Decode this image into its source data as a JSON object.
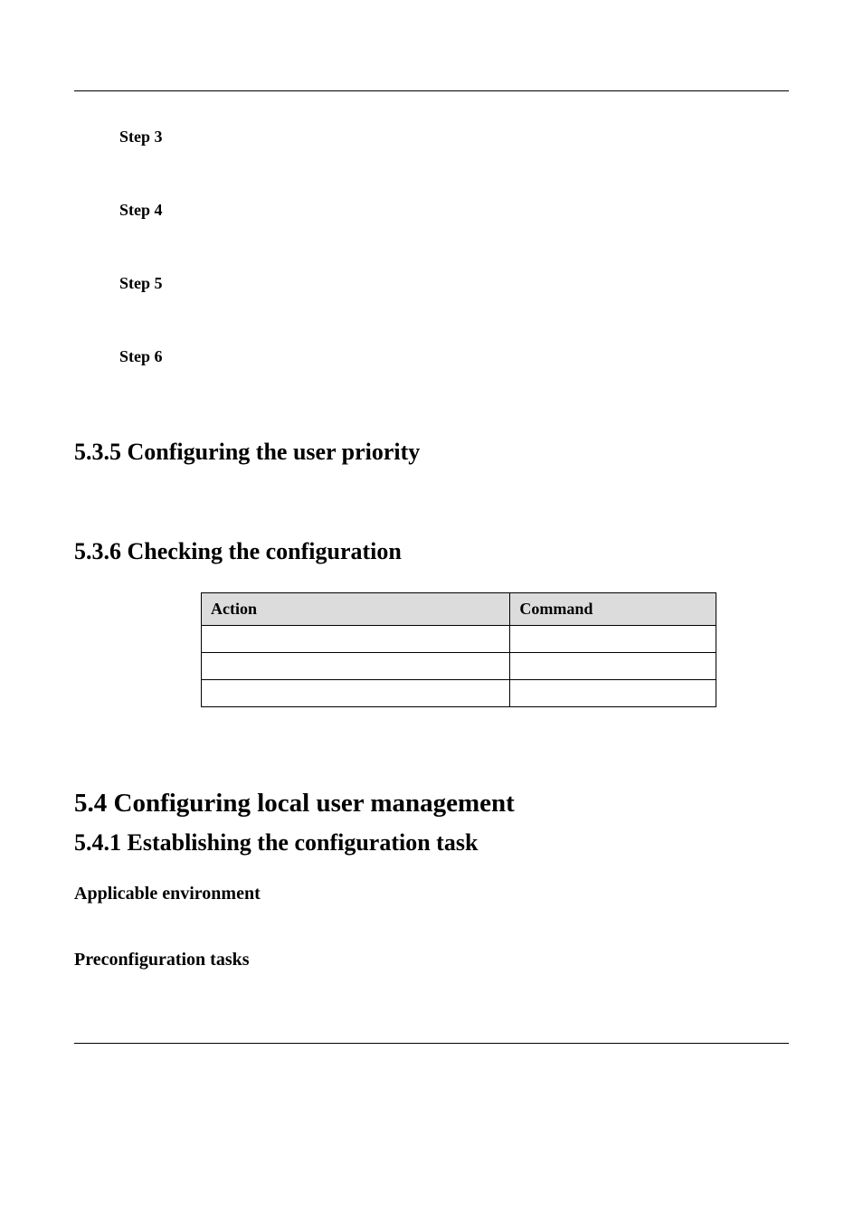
{
  "steps": {
    "s3": "Step 3",
    "s4": "Step 4",
    "s5": "Step 5",
    "s6": "Step 6"
  },
  "headings": {
    "h535": "5.3.5 Configuring the user priority",
    "h536": "5.3.6 Checking the configuration",
    "h54": "5.4 Configuring local user management",
    "h541": "5.4.1 Establishing the configuration task",
    "applicable_env": "Applicable environment",
    "preconfig_tasks": "Preconfiguration tasks"
  },
  "table": {
    "headers": {
      "action": "Action",
      "command": "Command"
    },
    "rows": [
      {
        "action": "",
        "command": ""
      },
      {
        "action": "",
        "command": ""
      },
      {
        "action": "",
        "command": ""
      }
    ]
  }
}
